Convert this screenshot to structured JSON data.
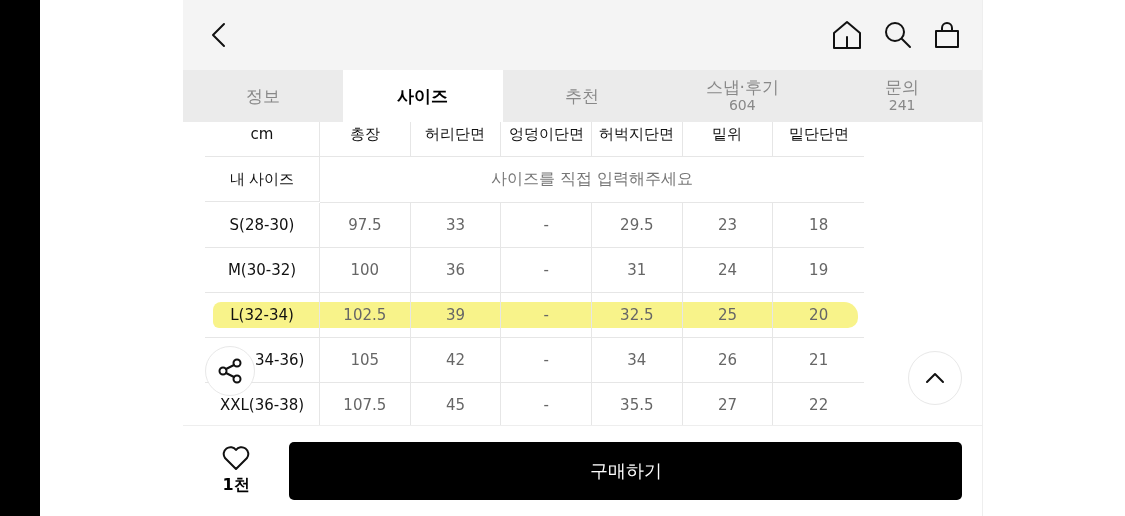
{
  "tabs": [
    {
      "label": "정보",
      "selected": false
    },
    {
      "label": "사이즈",
      "selected": true
    },
    {
      "label": "추천",
      "selected": false
    },
    {
      "label": "스냅·후기",
      "count": "604",
      "selected": false
    },
    {
      "label": "문의",
      "count": "241",
      "selected": false
    }
  ],
  "size_table": {
    "columns": [
      "cm",
      "총장",
      "허리단면",
      "엉덩이단면",
      "허벅지단면",
      "밑위",
      "밑단단면"
    ],
    "my_size": {
      "label": "내 사이즈",
      "placeholder": "사이즈를 직접 입력해주세요"
    },
    "rows": [
      {
        "size": "S(28-30)",
        "values": [
          "97.5",
          "33",
          "-",
          "29.5",
          "23",
          "18"
        ],
        "highlighted": false
      },
      {
        "size": "M(30-32)",
        "values": [
          "100",
          "36",
          "-",
          "31",
          "24",
          "19"
        ],
        "highlighted": false
      },
      {
        "size": "L(32-34)",
        "values": [
          "102.5",
          "39",
          "-",
          "32.5",
          "25",
          "20"
        ],
        "highlighted": true
      },
      {
        "size": "34-36)",
        "values": [
          "105",
          "42",
          "-",
          "34",
          "26",
          "21"
        ],
        "highlighted": false,
        "partly_hidden": true
      },
      {
        "size": "XXL(36-38)",
        "values": [
          "107.5",
          "45",
          "-",
          "35.5",
          "27",
          "22"
        ],
        "highlighted": false
      }
    ]
  },
  "like_count": "1천",
  "buy_button": "구매하기"
}
